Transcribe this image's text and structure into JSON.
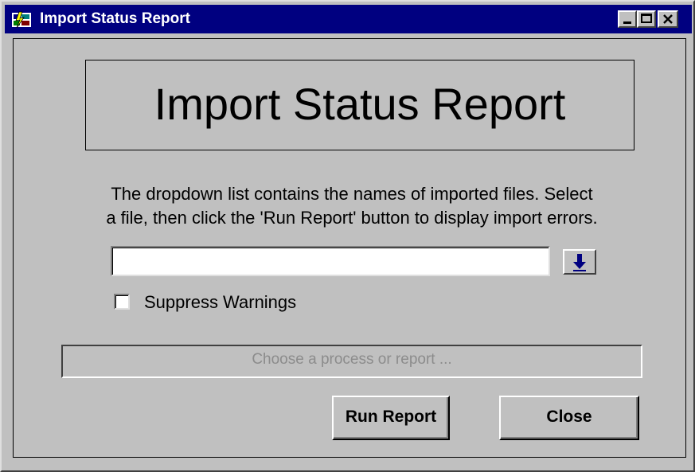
{
  "window": {
    "title": "Import Status Report",
    "controls": {
      "minimize_icon": "minimize-icon",
      "maximize_icon": "maximize-icon",
      "close_icon": "close-icon"
    },
    "titlebar_color": "#000080"
  },
  "banner": {
    "text": "Import Status Report"
  },
  "instructions": {
    "line1": "The dropdown list contains the names of imported files. Select",
    "line2": "a file, then click the 'Run Report' button to display import errors."
  },
  "file_select": {
    "value": "",
    "dropdown_icon": "arrow-down-icon"
  },
  "suppress_warnings": {
    "label": "Suppress Warnings",
    "checked": false
  },
  "status": {
    "text": "Choose a process or report ..."
  },
  "buttons": {
    "run_report": "Run Report",
    "close": "Close"
  }
}
